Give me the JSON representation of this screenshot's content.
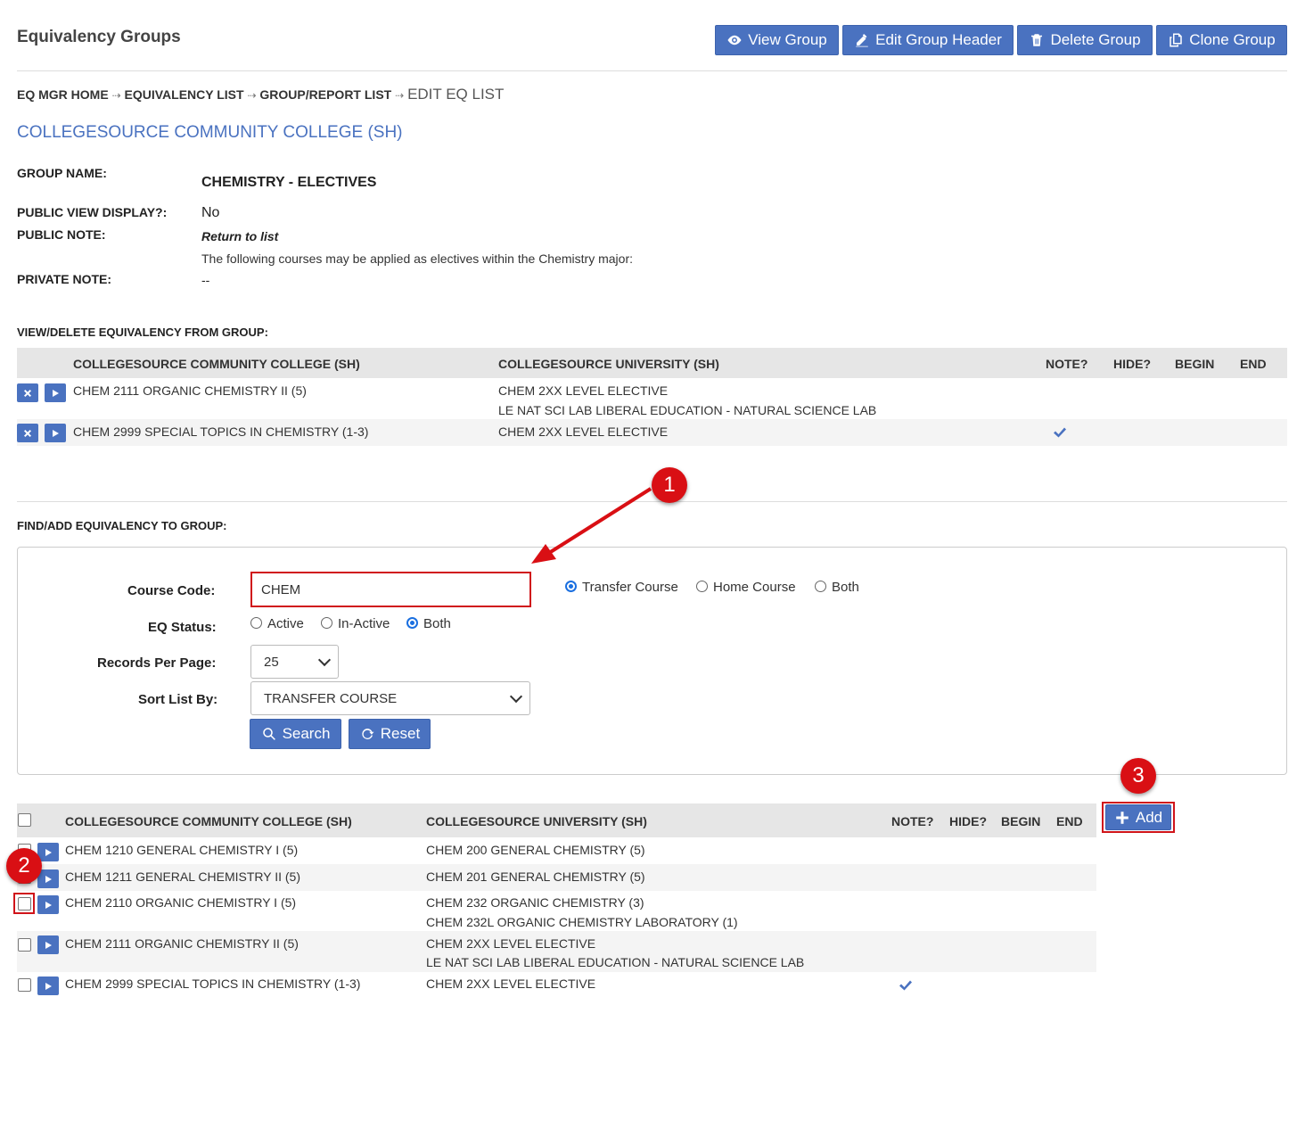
{
  "page": {
    "title": "Equivalency Groups",
    "institution": "COLLEGESOURCE COMMUNITY COLLEGE (SH)"
  },
  "toolbar": {
    "view_group": "View Group",
    "edit_header": "Edit Group Header",
    "delete_group": "Delete Group",
    "clone_group": "Clone Group"
  },
  "breadcrumb": {
    "home": "EQ MGR HOME",
    "eq_list": "EQUIVALENCY LIST",
    "group_list": "GROUP/REPORT LIST",
    "current": "EDIT EQ LIST",
    "sep": "⇢"
  },
  "group": {
    "name_label": "GROUP NAME:",
    "name": "CHEMISTRY - ELECTIVES",
    "public_view_label": "PUBLIC VIEW DISPLAY?:",
    "public_view": "No",
    "public_note_label": "PUBLIC NOTE:",
    "public_note_title": "Return to list",
    "public_note_text": "The following courses may be applied as electives within the Chemistry major:",
    "private_note_label": "PRIVATE NOTE:",
    "private_note": "--"
  },
  "view_section": {
    "heading": "VIEW/DELETE EQUIVALENCY FROM GROUP:",
    "columns": {
      "sending": "COLLEGESOURCE COMMUNITY COLLEGE (SH)",
      "receiving": "COLLEGESOURCE UNIVERSITY (SH)",
      "note": "NOTE?",
      "hide": "HIDE?",
      "begin": "BEGIN",
      "end": "END"
    },
    "rows": [
      {
        "sending": "CHEM 2111 ORGANIC CHEMISTRY II (5)",
        "receiving1": "CHEM 2XX LEVEL ELECTIVE",
        "receiving2": "LE NAT SCI LAB LIBERAL EDUCATION - NATURAL SCIENCE LAB"
      },
      {
        "sending": "CHEM 2999 SPECIAL TOPICS IN CHEMISTRY (1-3)",
        "receiving1": "CHEM 2XX LEVEL ELECTIVE",
        "receiving2": ""
      }
    ]
  },
  "find_section": {
    "heading": "FIND/ADD EQUIVALENCY TO GROUP:",
    "course_code_label": "Course Code:",
    "course_code_value": "CHEM",
    "course_type_options": [
      "Transfer Course",
      "Home Course",
      "Both"
    ],
    "eq_status_label": "EQ Status:",
    "eq_status_options": [
      "Active",
      "In-Active",
      "Both"
    ],
    "records_label": "Records Per Page:",
    "records_value": "25",
    "sort_label": "Sort List By:",
    "sort_value": "TRANSFER COURSE",
    "search_button": "Search",
    "reset_button": "Reset"
  },
  "results": {
    "add_button": "Add",
    "columns": {
      "sending": "COLLEGESOURCE COMMUNITY COLLEGE (SH)",
      "receiving": "COLLEGESOURCE UNIVERSITY (SH)",
      "note": "NOTE?",
      "hide": "HIDE?",
      "begin": "BEGIN",
      "end": "END"
    },
    "rows": [
      {
        "sending": "CHEM 1210 GENERAL CHEMISTRY I (5)",
        "receiving1": "CHEM 200 GENERAL CHEMISTRY (5)",
        "receiving2": ""
      },
      {
        "sending": "CHEM 1211 GENERAL CHEMISTRY II (5)",
        "receiving1": "CHEM 201 GENERAL CHEMISTRY (5)",
        "receiving2": ""
      },
      {
        "sending": "CHEM 2110 ORGANIC CHEMISTRY I (5)",
        "receiving1": "CHEM 232 ORGANIC CHEMISTRY (3)",
        "receiving2": "CHEM 232L ORGANIC CHEMISTRY LABORATORY (1)"
      },
      {
        "sending": "CHEM 2111 ORGANIC CHEMISTRY II (5)",
        "receiving1": "CHEM 2XX LEVEL ELECTIVE",
        "receiving2": "LE NAT SCI LAB LIBERAL EDUCATION - NATURAL SCIENCE LAB"
      },
      {
        "sending": "CHEM 2999 SPECIAL TOPICS IN CHEMISTRY (1-3)",
        "receiving1": "CHEM 2XX LEVEL ELECTIVE",
        "receiving2": ""
      }
    ]
  },
  "annotations": {
    "one": "1",
    "two": "2",
    "three": "3"
  },
  "colors": {
    "accent": "#4a72c0",
    "link": "#4a72c0",
    "callout": "#d90f14"
  }
}
